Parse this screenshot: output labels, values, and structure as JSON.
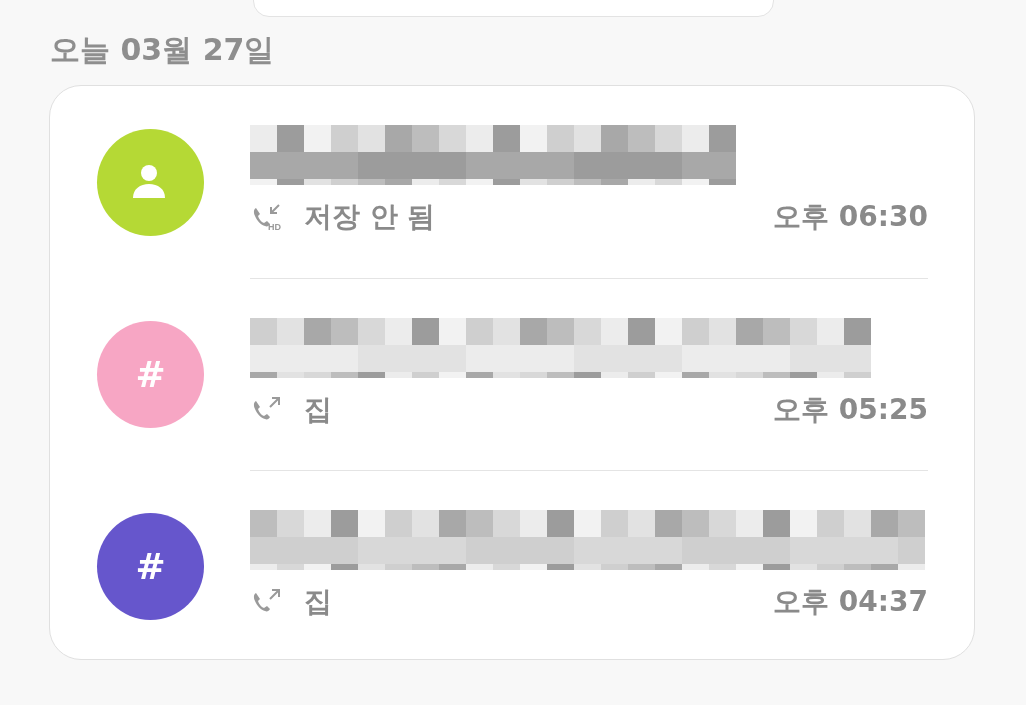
{
  "date_header": "오늘 03월 27일",
  "calls": [
    {
      "avatar": {
        "kind": "person",
        "color": "#b5d935"
      },
      "kind": "incoming",
      "icon_badge": "HD",
      "label": "저장 안 됨",
      "time": "오후 06:30"
    },
    {
      "avatar": {
        "kind": "hash",
        "color": "#f7a6c4",
        "symbol": "#"
      },
      "kind": "outgoing",
      "label": "집",
      "time": "오후 05:25"
    },
    {
      "avatar": {
        "kind": "hash",
        "color": "#6656cc",
        "symbol": "#"
      },
      "kind": "outgoing",
      "label": "집",
      "time": "오후 04:37"
    }
  ]
}
